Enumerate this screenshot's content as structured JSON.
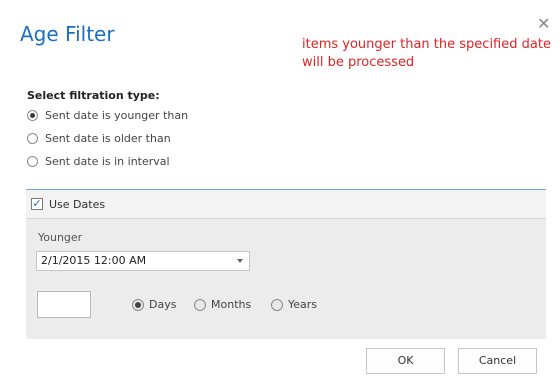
{
  "dialog": {
    "title": "Age Filter",
    "close_icon": "close-icon"
  },
  "annotation": {
    "line1": "items younger than the specified date",
    "line2": "will be processed",
    "color": "#e32222"
  },
  "filtration": {
    "label": "Select filtration type:",
    "options": [
      {
        "label": "Sent date is younger than",
        "selected": true
      },
      {
        "label": "Sent date is older than",
        "selected": false
      },
      {
        "label": "Sent date is in interval",
        "selected": false
      }
    ]
  },
  "use_dates": {
    "label": "Use Dates",
    "checked": true
  },
  "younger": {
    "label": "Younger",
    "date_value": "2/1/2015 12:00 AM",
    "number_value": ""
  },
  "units": {
    "options": [
      {
        "label": "Days",
        "selected": true
      },
      {
        "label": "Months",
        "selected": false
      },
      {
        "label": "Years",
        "selected": false
      }
    ]
  },
  "buttons": {
    "ok": "OK",
    "cancel": "Cancel"
  },
  "colors": {
    "title": "#1e6fc0",
    "divider": "#7aa6d6",
    "panel": "#ececec"
  }
}
